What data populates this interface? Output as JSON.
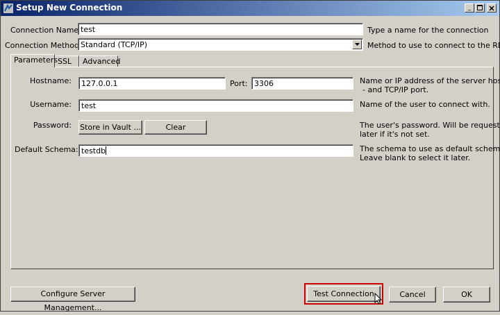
{
  "window": {
    "title": "Setup New Connection"
  },
  "connection_name": {
    "label": "Connection Name:",
    "value": "test",
    "help": "Type a name for the connection"
  },
  "connection_method": {
    "label": "Connection Method:",
    "value": "Standard (TCP/IP)",
    "help": "Method to use to connect to the RDBMS"
  },
  "tabs": [
    {
      "label": "Parameters"
    },
    {
      "label": "SSL"
    },
    {
      "label": "Advanced"
    }
  ],
  "hostname": {
    "label": "Hostname:",
    "value": "127.0.0.1",
    "help1": "Name or IP address of the server host.",
    "help2": "- and TCP/IP port."
  },
  "port": {
    "label": "Port:",
    "value": "3306"
  },
  "username": {
    "label": "Username:",
    "value": "test",
    "help": "Name of the user to connect with."
  },
  "password": {
    "label": "Password:",
    "store_btn": "Store in Vault ...",
    "clear_btn": "Clear",
    "help1": "The user's password. Will be requested",
    "help2": "later if it's not set."
  },
  "schema": {
    "label": "Default Schema:",
    "value": "testdb",
    "help1": "The schema to use as default schema.",
    "help2": "Leave blank to select it later."
  },
  "footer": {
    "configure_btn": "Configure Server Management...",
    "test_btn": "Test Connection",
    "cancel_btn": "Cancel",
    "ok_btn": "OK"
  },
  "colors": {
    "titlebar_start": "#0a246a",
    "titlebar_end": "#a6caf0",
    "highlight_border": "#cc0000"
  }
}
